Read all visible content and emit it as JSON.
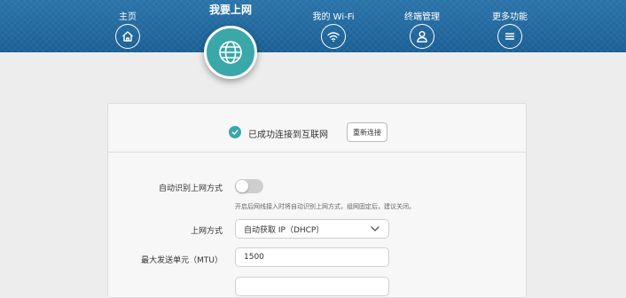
{
  "nav": {
    "items": [
      {
        "label": "主页",
        "icon": "home-icon"
      },
      {
        "label": "我要上网",
        "icon": "globe-icon",
        "active": true
      },
      {
        "label": "我的 Wi-Fi",
        "icon": "wifi-icon"
      },
      {
        "label": "终端管理",
        "icon": "user-icon"
      },
      {
        "label": "更多功能",
        "icon": "menu-icon"
      }
    ]
  },
  "status": {
    "text": "已成功连接到互联网",
    "reconnect_label": "重新连接"
  },
  "form": {
    "auto_detect_label": "自动识别上网方式",
    "auto_detect_on": false,
    "auto_detect_hint": "开启后网线接入时将自动识别上网方式，组网固定后，建议关闭。",
    "method_label": "上网方式",
    "method_value": "自动获取 IP（DHCP）",
    "mtu_label": "最大发送单元（MTU）",
    "mtu_value": "1500"
  },
  "colors": {
    "header_bg": "#1a5f95",
    "accent": "#3aa7a9",
    "page_bg": "#ededed"
  }
}
